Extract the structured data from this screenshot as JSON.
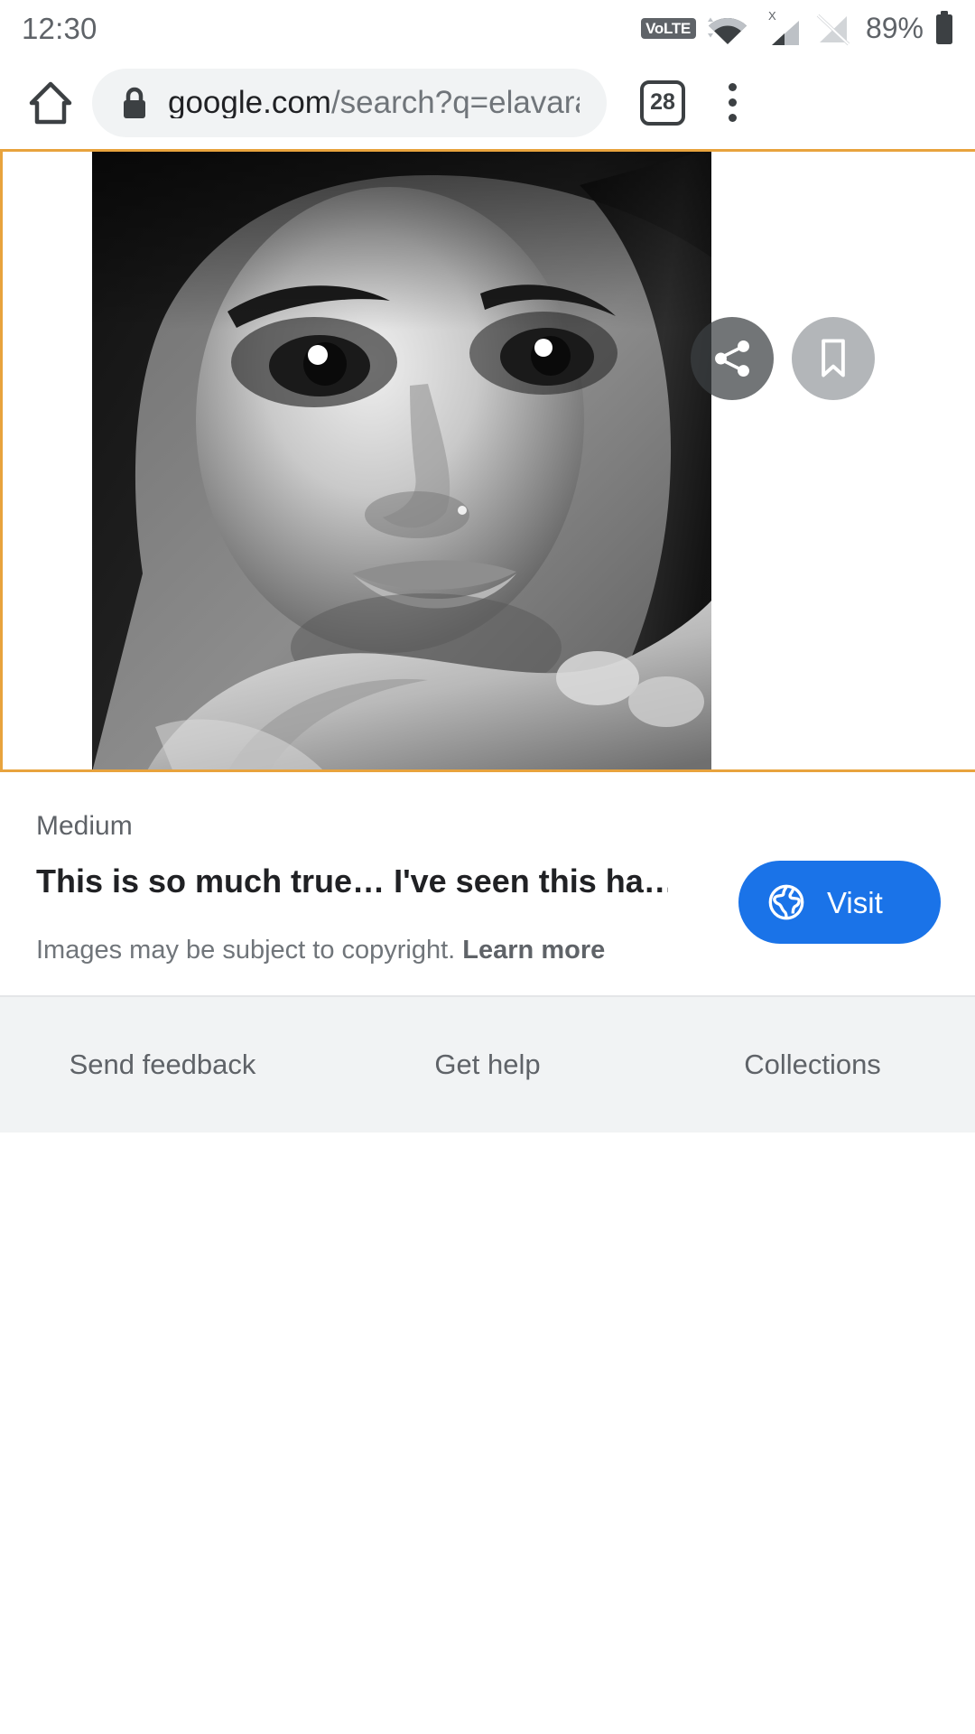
{
  "status_bar": {
    "time": "12:30",
    "volte_label": "VoLTE",
    "battery_percent": "89%",
    "icons": [
      "volte-badge",
      "wifi-icon",
      "signal-bars-icon",
      "signal-no-service-icon",
      "battery-icon"
    ]
  },
  "browser": {
    "home_icon": "home-icon",
    "lock_icon": "lock-icon",
    "url_domain": "google.com",
    "url_path": "/search?q=elavara",
    "url_full": "google.com/search?q=elavara",
    "tab_count": "28",
    "menu_icon": "overflow-menu-icon"
  },
  "image_viewer": {
    "border_color": "#e8a33d",
    "share_icon": "share-icon",
    "bookmark_icon": "bookmark-icon",
    "photo_alt": "black and white portrait of a woman resting chin on hand"
  },
  "info": {
    "source": "Medium",
    "title": "This is so much true… I've seen this ha…",
    "copyright_text": "Images may be subject to copyright.",
    "copyright_link": "Learn more",
    "visit_label": "Visit",
    "visit_icon": "globe-icon",
    "visit_color": "#1a73e8"
  },
  "footer": {
    "links": [
      {
        "label": "Send feedback"
      },
      {
        "label": "Get help"
      },
      {
        "label": "Collections"
      }
    ]
  }
}
